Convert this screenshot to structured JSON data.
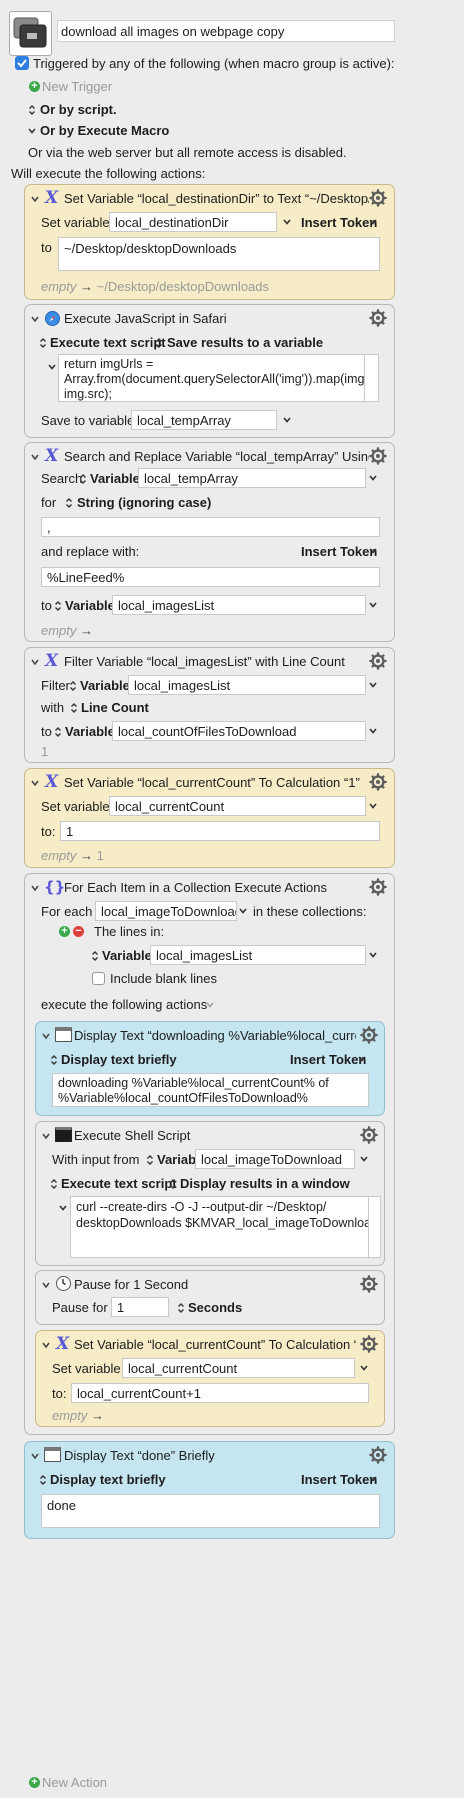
{
  "macro": {
    "name": "download all images on webpage copy",
    "trigger_label": "Triggered by any of the following (when macro group is active):",
    "new_trigger": "New Trigger",
    "or_script": "Or by script.",
    "or_execute": "Or by Execute Macro",
    "or_web": "Or via the web server but all remote access is disabled.",
    "will_execute": "Will execute the following actions:",
    "new_action": "New Action"
  },
  "common": {
    "insert_token": "Insert Token",
    "set_variable": "Set variable",
    "to": "to",
    "to_colon": "to:",
    "variable": "Variable",
    "empty": "empty",
    "arrow": "→"
  },
  "a1": {
    "title": "Set Variable “local_destinationDir” to Text “~/Desktop/d...",
    "var": "local_destinationDir",
    "text": "~/Desktop/desktopDownloads",
    "preview": "~/Desktop/desktopDownloads"
  },
  "a2": {
    "title": "Execute JavaScript in Safari",
    "mode": "Execute text script",
    "save": "Save results to a variable",
    "script": "return imgUrls =\nArray.from(document.querySelectorAll('img')).map(img =>\nimg.src);",
    "save_to_label": "Save to variable:",
    "save_to": "local_tempArray"
  },
  "a3": {
    "title": "Search and Replace Variable “local_tempArray” Using S...",
    "search_label": "Search",
    "search_var": "local_tempArray",
    "for_label": "for",
    "for_mode": "String (ignoring case)",
    "for_value": ",",
    "replace_label": "and replace with:",
    "replace_value": "%LineFeed%",
    "to_var": "local_imagesList"
  },
  "a4": {
    "title": "Filter Variable “local_imagesList” with Line Count",
    "filter_label": "Filter",
    "filter_var": "local_imagesList",
    "with_label": "with",
    "with_mode": "Line Count",
    "to_var": "local_countOfFilesToDownload",
    "result": "1"
  },
  "a5": {
    "title": "Set Variable “local_currentCount” To Calculation “1”",
    "var": "local_currentCount",
    "calc": "1",
    "preview": "1"
  },
  "a6": {
    "title": "For Each Item in a Collection Execute Actions",
    "for_each_label": "For each",
    "item_var": "local_imageToDownload",
    "in_collections": "in these collections:",
    "lines_in": "The lines in:",
    "lines_var": "local_imagesList",
    "include_blank": "Include blank lines",
    "execute_label": "execute the following actions"
  },
  "a7": {
    "title": "Display Text “downloading %Variable%local_current...",
    "mode": "Display text briefly",
    "text": "downloading %Variable%local_currentCount% of\n%Variable%local_countOfFilesToDownload%"
  },
  "a8": {
    "title": "Execute Shell Script",
    "input_label": "With input from",
    "input_var": "local_imageToDownload",
    "mode": "Execute text script",
    "display": "Display results in a window",
    "script": "curl --create-dirs -O -J --output-dir ~/Desktop/\ndesktopDownloads $KMVAR_local_imageToDownload"
  },
  "a9": {
    "title": "Pause for 1 Second",
    "pause_label": "Pause for",
    "pause_value": "1",
    "unit": "Seconds"
  },
  "a10": {
    "title": "Set Variable “local_currentCount” To Calculation “lo...",
    "var": "local_currentCount",
    "calc": "local_currentCount+1"
  },
  "a11": {
    "title": "Display Text “done” Briefly",
    "mode": "Display text briefly",
    "text": "done"
  },
  "colors": {
    "yellow": "#f6ecc8",
    "blue": "#c5e5f0",
    "gray": "#ececec",
    "accent": "#2f7fe0",
    "variable_x": "#5a5ad8"
  }
}
